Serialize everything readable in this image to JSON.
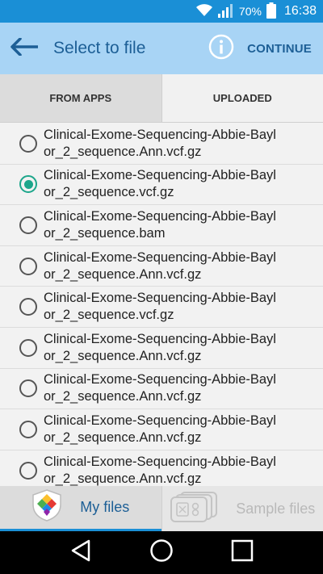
{
  "status_bar": {
    "battery_percent": "70%",
    "time": "16:38"
  },
  "app_bar": {
    "title": "Select to file",
    "continue_label": "CONTINUE"
  },
  "tabs": [
    {
      "label": "FROM APPS",
      "active": true
    },
    {
      "label": "UPLOADED",
      "active": false
    }
  ],
  "files": [
    {
      "name": "Clinical-Exome-Sequencing-Abbie-Baylor_2_sequence.Ann.vcf.gz",
      "selected": false
    },
    {
      "name": "Clinical-Exome-Sequencing-Abbie-Baylor_2_sequence.vcf.gz",
      "selected": true
    },
    {
      "name": "Clinical-Exome-Sequencing-Abbie-Baylor_2_sequence.bam",
      "selected": false
    },
    {
      "name": "Clinical-Exome-Sequencing-Abbie-Baylor_2_sequence.Ann.vcf.gz",
      "selected": false
    },
    {
      "name": "Clinical-Exome-Sequencing-Abbie-Baylor_2_sequence.vcf.gz",
      "selected": false
    },
    {
      "name": "Clinical-Exome-Sequencing-Abbie-Baylor_2_sequence.Ann.vcf.gz",
      "selected": false
    },
    {
      "name": "Clinical-Exome-Sequencing-Abbie-Baylor_2_sequence.Ann.vcf.gz",
      "selected": false
    },
    {
      "name": "Clinical-Exome-Sequencing-Abbie-Baylor_2_sequence.Ann.vcf.gz",
      "selected": false
    },
    {
      "name": "Clinical-Exome-Sequencing-Abbie-Baylor_2_sequence.Ann.vcf.gz",
      "selected": false
    }
  ],
  "bottom_tabs": {
    "my_files": "My files",
    "sample_files": "Sample files"
  },
  "icons": {
    "back": "arrow-left-icon",
    "info": "info-icon",
    "radio_checked_color": "#1da68b",
    "accent": "#1a8fd6"
  }
}
